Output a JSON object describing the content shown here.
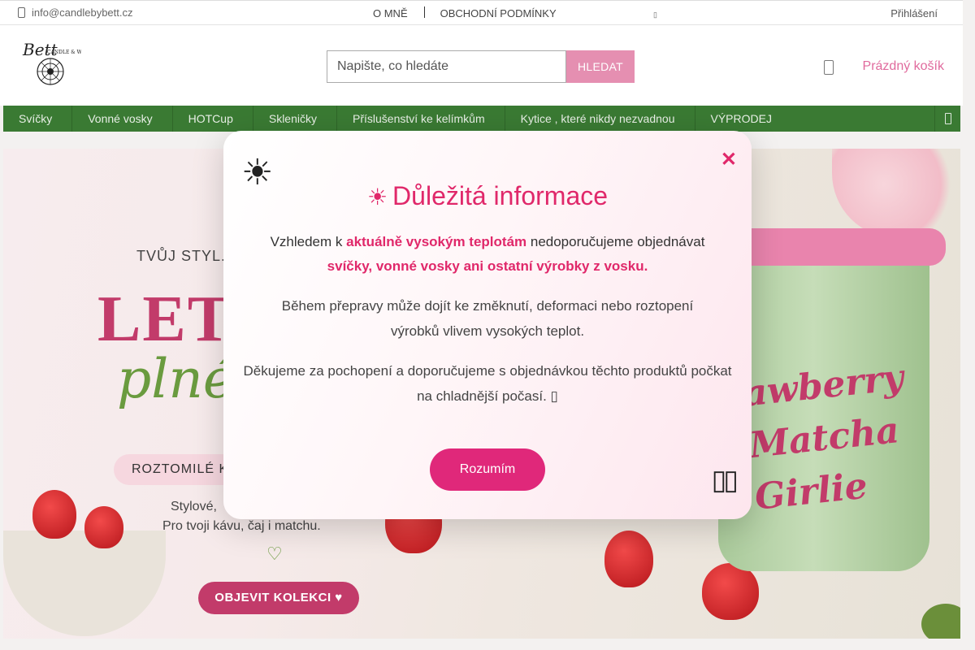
{
  "topbar": {
    "email": "info@candlebybett.cz",
    "links": [
      "O MNĚ",
      "OBCHODNÍ PODMÍNKY"
    ],
    "lang_icon": "▯",
    "login": "Přihlášení"
  },
  "header": {
    "logo_alt": "Bett Candle & Wax logo",
    "search_placeholder": "Napište, co hledáte",
    "search_button": "HLEDAT",
    "cart_label": "Prázdný košík"
  },
  "nav": {
    "items": [
      {
        "label": "Svíčky"
      },
      {
        "label": "Vonné vosky"
      },
      {
        "label": "HOTCup"
      },
      {
        "label": "Skleničky"
      },
      {
        "label": "Příslušenství ke kelímkům"
      },
      {
        "label": "Kytice , které nikdy nezvadnou"
      },
      {
        "label": "VÝPRODEJ"
      }
    ],
    "caret": ""
  },
  "banner": {
    "slogan": "TVŮJ STYL.",
    "big": "LET",
    "script": "plné",
    "pill": "ROZTOMILÉ K",
    "line1": "Stylové,",
    "line2": "Pro tvoji kávu, čaj i matchu.",
    "heart": "♡",
    "cta": "OBJEVIT KOLEKCI ♥",
    "cup_text_1": "awberry",
    "cup_text_2": "Matcha",
    "cup_text_3": "Girlie"
  },
  "modal": {
    "sun_icon": "☀",
    "close": "✕",
    "title_icon": "☀",
    "title": "Důležitá informace",
    "p1_pre": "Vzhledem k ",
    "p1_strong": "aktuálně vysokým teplotám",
    "p1_post": " nedoporučujeme objednávat",
    "p1_strong2": "svíčky, vonné vosky ani ostatní výrobky z vosku.",
    "p2": "Během přepravy může dojít ke změknutí, deformaci nebo roztopení výrobků vlivem vysokých teplot.",
    "p3": "Děkujeme za pochopení a doporučujeme s objednávkou těchto produktů počkat na chladnější počasí. ▯",
    "ok_button": "Rozumím",
    "corner_icon": "▯▯"
  },
  "colors": {
    "accent_pink": "#e0286a",
    "nav_green": "#3a7a33",
    "search_button": "#e58fb1"
  }
}
